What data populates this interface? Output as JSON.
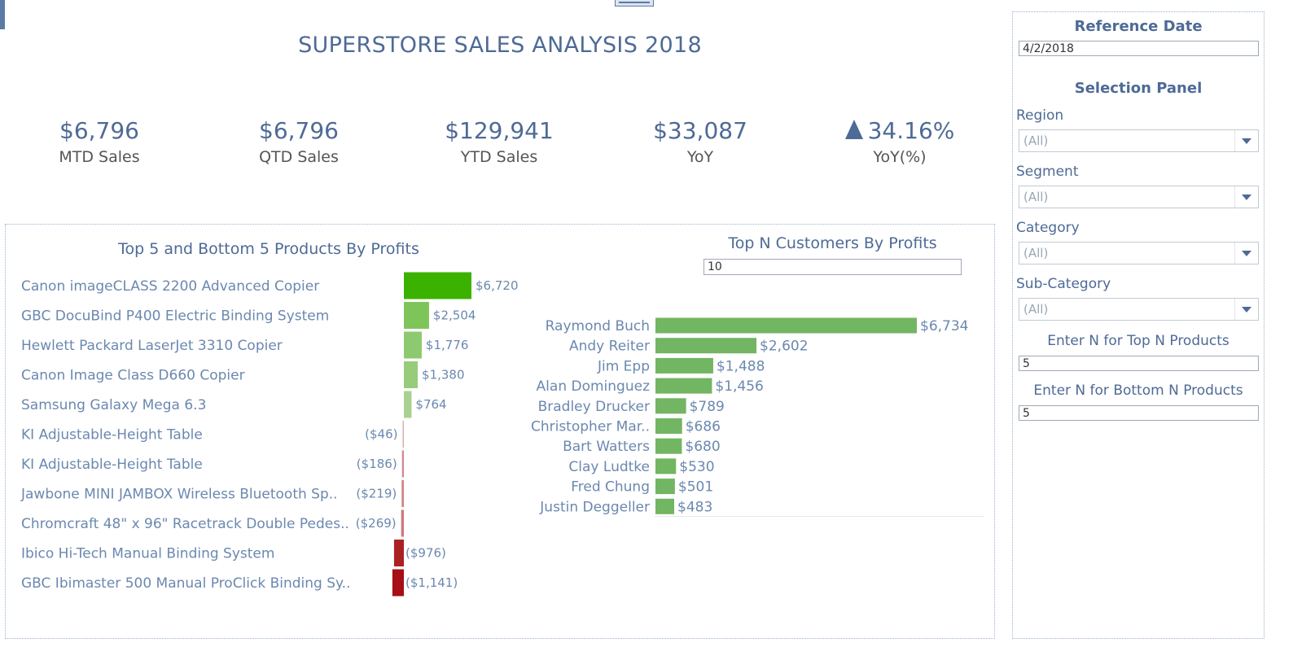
{
  "page_title": "SUPERSTORE SALES ANALYSIS 2018",
  "kpis": [
    {
      "value": "$6,796",
      "label": "MTD Sales"
    },
    {
      "value": "$6,796",
      "label": "QTD Sales"
    },
    {
      "value": "$129,941",
      "label": "YTD Sales"
    },
    {
      "value": "$33,087",
      "label": "YoY"
    },
    {
      "value": "34.16%",
      "label": "YoY(%)",
      "indicator": "up-triangle-icon"
    }
  ],
  "colors": {
    "text": "#4e6a96",
    "positive_strong": "#3cb200",
    "negative_strong": "#a50f15",
    "customer_bar": "#72b562"
  },
  "chart_data": [
    {
      "type": "bar",
      "orientation": "horizontal",
      "title": "Top 5 and Bottom 5 Products By Profits",
      "categories": [
        "Canon imageCLASS 2200 Advanced Copier",
        "GBC DocuBind P400 Electric Binding System",
        "Hewlett Packard LaserJet 3310 Copier",
        "Canon Image Class D660 Copier",
        "Samsung Galaxy Mega 6.3",
        "KI Adjustable-Height Table",
        "KI Adjustable-Height Table",
        "Jawbone MINI JAMBOX Wireless Bluetooth Sp..",
        "Chromcraft 48\" x 96\" Racetrack Double Pedes..",
        "Ibico Hi-Tech Manual Binding System",
        "GBC Ibimaster 500 Manual ProClick Binding Sy.."
      ],
      "values": [
        6720,
        2504,
        1776,
        1380,
        764,
        -46,
        -186,
        -219,
        -269,
        -976,
        -1141
      ],
      "value_labels": [
        "$6,720",
        "$2,504",
        "$1,776",
        "$1,380",
        "$764",
        "($46)",
        "($186)",
        "($219)",
        "($269)",
        "($976)",
        "($1,141)"
      ],
      "color_scale": "diverging red-green by profit"
    },
    {
      "type": "bar",
      "orientation": "horizontal",
      "title": "Top N Customers By Profits",
      "categories": [
        "Raymond Buch",
        "Andy Reiter",
        "Jim Epp",
        "Alan Dominguez",
        "Bradley Drucker",
        "Christopher Mar..",
        "Bart Watters",
        "Clay Ludtke",
        "Fred Chung",
        "Justin Deggeller"
      ],
      "values": [
        6734,
        2602,
        1488,
        1456,
        789,
        686,
        680,
        530,
        501,
        483
      ],
      "value_labels": [
        "$6,734",
        "$2,602",
        "$1,488",
        "$1,456",
        "$789",
        "$686",
        "$680",
        "$530",
        "$501",
        "$483"
      ]
    }
  ],
  "customers_n_input": "10",
  "side_panel": {
    "reference_date_title": "Reference Date",
    "reference_date_value": "4/2/2018",
    "selection_title": "Selection Panel",
    "filters": [
      {
        "label": "Region",
        "value": "(All)"
      },
      {
        "label": "Segment",
        "value": "(All)"
      },
      {
        "label": "Category",
        "value": "(All)"
      },
      {
        "label": "Sub-Category",
        "value": "(All)"
      }
    ],
    "top_n_label": "Enter N for Top N Products",
    "top_n_value": "5",
    "bottom_n_label": "Enter N for Bottom N Products",
    "bottom_n_value": "5"
  }
}
